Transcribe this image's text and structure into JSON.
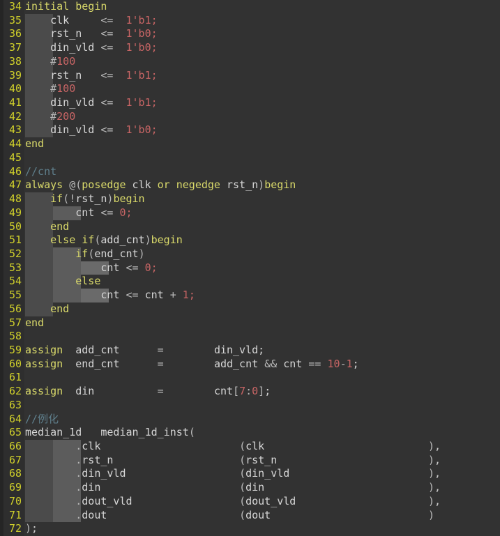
{
  "editor": {
    "theme": "dark",
    "language": "verilog",
    "colors": {
      "background": "#323232",
      "gutter": "#2e2e2e",
      "left_strip": "#252525",
      "line_number": "#cfcf2b",
      "keyword": "#d9d96a",
      "identifier": "#d6d6d6",
      "number": "#c86565",
      "comment": "#5f7f8c",
      "operator": "#b9b9b9",
      "indent_guide_1": "#4b4b4b",
      "indent_guide_2": "#5c5c5c"
    },
    "first_line": 34,
    "last_line": 72
  },
  "lines": [
    {
      "n": "34",
      "indents": [],
      "tokens": [
        {
          "t": "initial",
          "c": "kw"
        },
        {
          "t": " ",
          "c": "plain"
        },
        {
          "t": "begin",
          "c": "kw"
        }
      ]
    },
    {
      "n": "35",
      "indents": [
        4
      ],
      "tokens": [
        {
          "t": "    ",
          "c": "plain"
        },
        {
          "t": "clk",
          "c": "id"
        },
        {
          "t": "     ",
          "c": "plain"
        },
        {
          "t": "<=",
          "c": "op"
        },
        {
          "t": "  ",
          "c": "plain"
        },
        {
          "t": "1'b1",
          "c": "num"
        },
        {
          "t": ";",
          "c": "num"
        }
      ]
    },
    {
      "n": "36",
      "indents": [
        4
      ],
      "tokens": [
        {
          "t": "    ",
          "c": "plain"
        },
        {
          "t": "rst_n",
          "c": "id"
        },
        {
          "t": "   ",
          "c": "plain"
        },
        {
          "t": "<=",
          "c": "op"
        },
        {
          "t": "  ",
          "c": "plain"
        },
        {
          "t": "1'b0",
          "c": "num"
        },
        {
          "t": ";",
          "c": "num"
        }
      ]
    },
    {
      "n": "37",
      "indents": [
        4
      ],
      "tokens": [
        {
          "t": "    ",
          "c": "plain"
        },
        {
          "t": "din_vld",
          "c": "id"
        },
        {
          "t": " ",
          "c": "plain"
        },
        {
          "t": "<=",
          "c": "op"
        },
        {
          "t": "  ",
          "c": "plain"
        },
        {
          "t": "1'b0",
          "c": "num"
        },
        {
          "t": ";",
          "c": "num"
        }
      ]
    },
    {
      "n": "38",
      "indents": [
        4
      ],
      "tokens": [
        {
          "t": "    ",
          "c": "plain"
        },
        {
          "t": "#",
          "c": "op"
        },
        {
          "t": "100",
          "c": "num"
        }
      ]
    },
    {
      "n": "39",
      "indents": [
        4
      ],
      "tokens": [
        {
          "t": "    ",
          "c": "plain"
        },
        {
          "t": "rst_n",
          "c": "id"
        },
        {
          "t": "   ",
          "c": "plain"
        },
        {
          "t": "<=",
          "c": "op"
        },
        {
          "t": "  ",
          "c": "plain"
        },
        {
          "t": "1'b1",
          "c": "num"
        },
        {
          "t": ";",
          "c": "num"
        }
      ]
    },
    {
      "n": "40",
      "indents": [
        4
      ],
      "tokens": [
        {
          "t": "    ",
          "c": "plain"
        },
        {
          "t": "#",
          "c": "op"
        },
        {
          "t": "100",
          "c": "num"
        }
      ]
    },
    {
      "n": "41",
      "indents": [
        4
      ],
      "tokens": [
        {
          "t": "    ",
          "c": "plain"
        },
        {
          "t": "din_vld",
          "c": "id"
        },
        {
          "t": " ",
          "c": "plain"
        },
        {
          "t": "<=",
          "c": "op"
        },
        {
          "t": "  ",
          "c": "plain"
        },
        {
          "t": "1'b1",
          "c": "num"
        },
        {
          "t": ";",
          "c": "num"
        }
      ]
    },
    {
      "n": "42",
      "indents": [
        4
      ],
      "tokens": [
        {
          "t": "    ",
          "c": "plain"
        },
        {
          "t": "#",
          "c": "op"
        },
        {
          "t": "200",
          "c": "num"
        }
      ]
    },
    {
      "n": "43",
      "indents": [
        4
      ],
      "tokens": [
        {
          "t": "    ",
          "c": "plain"
        },
        {
          "t": "din_vld",
          "c": "id"
        },
        {
          "t": " ",
          "c": "plain"
        },
        {
          "t": "<=",
          "c": "op"
        },
        {
          "t": "  ",
          "c": "plain"
        },
        {
          "t": "1'b0",
          "c": "num"
        },
        {
          "t": ";",
          "c": "num"
        }
      ]
    },
    {
      "n": "44",
      "indents": [],
      "tokens": [
        {
          "t": "end",
          "c": "kw"
        }
      ]
    },
    {
      "n": "45",
      "indents": [],
      "tokens": []
    },
    {
      "n": "46",
      "indents": [],
      "tokens": [
        {
          "t": "//cnt",
          "c": "cmt"
        }
      ]
    },
    {
      "n": "47",
      "indents": [],
      "tokens": [
        {
          "t": "always",
          "c": "kw"
        },
        {
          "t": " ",
          "c": "plain"
        },
        {
          "t": "@(",
          "c": "op"
        },
        {
          "t": "posedge",
          "c": "kw"
        },
        {
          "t": " ",
          "c": "plain"
        },
        {
          "t": "clk",
          "c": "id"
        },
        {
          "t": " ",
          "c": "plain"
        },
        {
          "t": "or",
          "c": "kw"
        },
        {
          "t": " ",
          "c": "plain"
        },
        {
          "t": "negedge",
          "c": "kw"
        },
        {
          "t": " ",
          "c": "plain"
        },
        {
          "t": "rst_n",
          "c": "id"
        },
        {
          "t": ")",
          "c": "op"
        },
        {
          "t": "begin",
          "c": "kw"
        }
      ]
    },
    {
      "n": "48",
      "indents": [
        4
      ],
      "tokens": [
        {
          "t": "    ",
          "c": "plain"
        },
        {
          "t": "if",
          "c": "kw"
        },
        {
          "t": "(",
          "c": "op"
        },
        {
          "t": "!",
          "c": "op"
        },
        {
          "t": "rst_n",
          "c": "id"
        },
        {
          "t": ")",
          "c": "op"
        },
        {
          "t": "begin",
          "c": "kw"
        }
      ]
    },
    {
      "n": "49",
      "indents": [
        4,
        8
      ],
      "tokens": [
        {
          "t": "        ",
          "c": "plain"
        },
        {
          "t": "cnt",
          "c": "id"
        },
        {
          "t": " ",
          "c": "plain"
        },
        {
          "t": "<=",
          "c": "op"
        },
        {
          "t": " ",
          "c": "plain"
        },
        {
          "t": "0",
          "c": "num"
        },
        {
          "t": ";",
          "c": "num"
        }
      ]
    },
    {
      "n": "50",
      "indents": [
        4
      ],
      "tokens": [
        {
          "t": "    ",
          "c": "plain"
        },
        {
          "t": "end",
          "c": "kw"
        }
      ]
    },
    {
      "n": "51",
      "indents": [
        4
      ],
      "tokens": [
        {
          "t": "    ",
          "c": "plain"
        },
        {
          "t": "else",
          "c": "kw"
        },
        {
          "t": " ",
          "c": "plain"
        },
        {
          "t": "if",
          "c": "kw"
        },
        {
          "t": "(",
          "c": "op"
        },
        {
          "t": "add_cnt",
          "c": "id"
        },
        {
          "t": ")",
          "c": "op"
        },
        {
          "t": "begin",
          "c": "kw"
        }
      ]
    },
    {
      "n": "52",
      "indents": [
        4,
        8
      ],
      "tokens": [
        {
          "t": "        ",
          "c": "plain"
        },
        {
          "t": "if",
          "c": "kw"
        },
        {
          "t": "(",
          "c": "op"
        },
        {
          "t": "end_cnt",
          "c": "id"
        },
        {
          "t": ")",
          "c": "op"
        }
      ]
    },
    {
      "n": "53",
      "indents": [
        4,
        8,
        12
      ],
      "tokens": [
        {
          "t": "            ",
          "c": "plain"
        },
        {
          "t": "cnt",
          "c": "id"
        },
        {
          "t": " ",
          "c": "plain"
        },
        {
          "t": "<=",
          "c": "op"
        },
        {
          "t": " ",
          "c": "plain"
        },
        {
          "t": "0",
          "c": "num"
        },
        {
          "t": ";",
          "c": "num"
        }
      ]
    },
    {
      "n": "54",
      "indents": [
        4,
        8
      ],
      "tokens": [
        {
          "t": "        ",
          "c": "plain"
        },
        {
          "t": "else",
          "c": "kw"
        }
      ]
    },
    {
      "n": "55",
      "indents": [
        4,
        8,
        12
      ],
      "tokens": [
        {
          "t": "            ",
          "c": "plain"
        },
        {
          "t": "cnt",
          "c": "id"
        },
        {
          "t": " ",
          "c": "plain"
        },
        {
          "t": "<=",
          "c": "op"
        },
        {
          "t": " ",
          "c": "plain"
        },
        {
          "t": "cnt",
          "c": "id"
        },
        {
          "t": " ",
          "c": "plain"
        },
        {
          "t": "+",
          "c": "op"
        },
        {
          "t": " ",
          "c": "plain"
        },
        {
          "t": "1",
          "c": "num"
        },
        {
          "t": ";",
          "c": "num"
        }
      ]
    },
    {
      "n": "56",
      "indents": [
        4
      ],
      "tokens": [
        {
          "t": "    ",
          "c": "plain"
        },
        {
          "t": "end",
          "c": "kw"
        }
      ]
    },
    {
      "n": "57",
      "indents": [],
      "tokens": [
        {
          "t": "end",
          "c": "kw"
        }
      ]
    },
    {
      "n": "58",
      "indents": [],
      "tokens": []
    },
    {
      "n": "59",
      "indents": [],
      "tokens": [
        {
          "t": "assign",
          "c": "kw"
        },
        {
          "t": "  ",
          "c": "plain"
        },
        {
          "t": "add_cnt",
          "c": "id"
        },
        {
          "t": "      ",
          "c": "plain"
        },
        {
          "t": "=",
          "c": "op"
        },
        {
          "t": "        ",
          "c": "plain"
        },
        {
          "t": "din_vld",
          "c": "id"
        },
        {
          "t": ";",
          "c": "punct"
        }
      ]
    },
    {
      "n": "60",
      "indents": [],
      "tokens": [
        {
          "t": "assign",
          "c": "kw"
        },
        {
          "t": "  ",
          "c": "plain"
        },
        {
          "t": "end_cnt",
          "c": "id"
        },
        {
          "t": "      ",
          "c": "plain"
        },
        {
          "t": "=",
          "c": "op"
        },
        {
          "t": "        ",
          "c": "plain"
        },
        {
          "t": "add_cnt",
          "c": "id"
        },
        {
          "t": " ",
          "c": "plain"
        },
        {
          "t": "&&",
          "c": "op"
        },
        {
          "t": " ",
          "c": "plain"
        },
        {
          "t": "cnt",
          "c": "id"
        },
        {
          "t": " ",
          "c": "plain"
        },
        {
          "t": "==",
          "c": "op"
        },
        {
          "t": " ",
          "c": "plain"
        },
        {
          "t": "10",
          "c": "num"
        },
        {
          "t": "-",
          "c": "op"
        },
        {
          "t": "1",
          "c": "num"
        },
        {
          "t": ";",
          "c": "punct"
        }
      ]
    },
    {
      "n": "61",
      "indents": [],
      "tokens": []
    },
    {
      "n": "62",
      "indents": [],
      "tokens": [
        {
          "t": "assign",
          "c": "kw"
        },
        {
          "t": "  ",
          "c": "plain"
        },
        {
          "t": "din",
          "c": "id"
        },
        {
          "t": "          ",
          "c": "plain"
        },
        {
          "t": "=",
          "c": "op"
        },
        {
          "t": "        ",
          "c": "plain"
        },
        {
          "t": "cnt",
          "c": "id"
        },
        {
          "t": "[",
          "c": "op"
        },
        {
          "t": "7",
          "c": "num"
        },
        {
          "t": ":",
          "c": "op"
        },
        {
          "t": "0",
          "c": "num"
        },
        {
          "t": "]",
          "c": "op"
        },
        {
          "t": ";",
          "c": "punct"
        }
      ]
    },
    {
      "n": "63",
      "indents": [],
      "tokens": []
    },
    {
      "n": "64",
      "indents": [],
      "tokens": [
        {
          "t": "//例化",
          "c": "cmt"
        }
      ]
    },
    {
      "n": "65",
      "indents": [],
      "tokens": [
        {
          "t": "median_1d",
          "c": "id"
        },
        {
          "t": "   ",
          "c": "plain"
        },
        {
          "t": "median_1d_inst",
          "c": "id"
        },
        {
          "t": "(",
          "c": "op"
        }
      ]
    },
    {
      "n": "66",
      "indents": [
        4,
        8
      ],
      "tokens": [
        {
          "t": "        ",
          "c": "plain"
        },
        {
          "t": ".",
          "c": "op"
        },
        {
          "t": "clk",
          "c": "id"
        },
        {
          "t": "                      ",
          "c": "plain"
        },
        {
          "t": "(",
          "c": "op"
        },
        {
          "t": "clk",
          "c": "id"
        },
        {
          "t": "                          ",
          "c": "plain"
        },
        {
          "t": ")",
          "c": "op"
        },
        {
          "t": ",",
          "c": "punct"
        }
      ]
    },
    {
      "n": "67",
      "indents": [
        4,
        8
      ],
      "tokens": [
        {
          "t": "        ",
          "c": "plain"
        },
        {
          "t": ".",
          "c": "op"
        },
        {
          "t": "rst_n",
          "c": "id"
        },
        {
          "t": "                    ",
          "c": "plain"
        },
        {
          "t": "(",
          "c": "op"
        },
        {
          "t": "rst_n",
          "c": "id"
        },
        {
          "t": "                        ",
          "c": "plain"
        },
        {
          "t": ")",
          "c": "op"
        },
        {
          "t": ",",
          "c": "punct"
        }
      ]
    },
    {
      "n": "68",
      "indents": [
        4,
        8
      ],
      "tokens": [
        {
          "t": "        ",
          "c": "plain"
        },
        {
          "t": ".",
          "c": "op"
        },
        {
          "t": "din_vld",
          "c": "id"
        },
        {
          "t": "                  ",
          "c": "plain"
        },
        {
          "t": "(",
          "c": "op"
        },
        {
          "t": "din_vld",
          "c": "id"
        },
        {
          "t": "                      ",
          "c": "plain"
        },
        {
          "t": ")",
          "c": "op"
        },
        {
          "t": ",",
          "c": "punct"
        }
      ]
    },
    {
      "n": "69",
      "indents": [
        4,
        8
      ],
      "tokens": [
        {
          "t": "        ",
          "c": "plain"
        },
        {
          "t": ".",
          "c": "op"
        },
        {
          "t": "din",
          "c": "id"
        },
        {
          "t": "                      ",
          "c": "plain"
        },
        {
          "t": "(",
          "c": "op"
        },
        {
          "t": "din",
          "c": "id"
        },
        {
          "t": "                          ",
          "c": "plain"
        },
        {
          "t": ")",
          "c": "op"
        },
        {
          "t": ",",
          "c": "punct"
        }
      ]
    },
    {
      "n": "70",
      "indents": [
        4,
        8
      ],
      "tokens": [
        {
          "t": "        ",
          "c": "plain"
        },
        {
          "t": ".",
          "c": "op"
        },
        {
          "t": "dout_vld",
          "c": "id"
        },
        {
          "t": "                 ",
          "c": "plain"
        },
        {
          "t": "(",
          "c": "op"
        },
        {
          "t": "dout_vld",
          "c": "id"
        },
        {
          "t": "                     ",
          "c": "plain"
        },
        {
          "t": ")",
          "c": "op"
        },
        {
          "t": ",",
          "c": "punct"
        }
      ]
    },
    {
      "n": "71",
      "indents": [
        4,
        8
      ],
      "tokens": [
        {
          "t": "        ",
          "c": "plain"
        },
        {
          "t": ".",
          "c": "op"
        },
        {
          "t": "dout",
          "c": "id"
        },
        {
          "t": "                     ",
          "c": "plain"
        },
        {
          "t": "(",
          "c": "op"
        },
        {
          "t": "dout",
          "c": "id"
        },
        {
          "t": "                         ",
          "c": "plain"
        },
        {
          "t": ")",
          "c": "op"
        }
      ]
    },
    {
      "n": "72",
      "indents": [],
      "tokens": [
        {
          "t": ")",
          "c": "op"
        },
        {
          "t": ";",
          "c": "punct"
        }
      ]
    }
  ]
}
